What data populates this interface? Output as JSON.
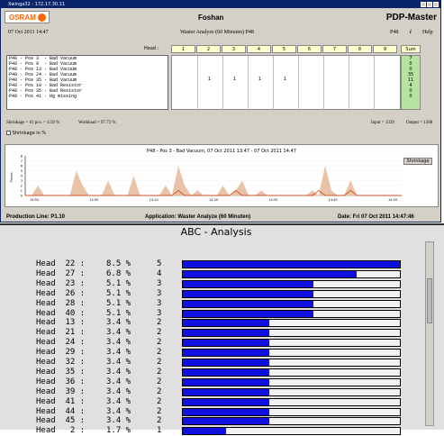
{
  "window": {
    "title": "Xwinga32 - 172.17.30.11"
  },
  "header": {
    "brand": "OSRAM",
    "city": "Foshan",
    "app": "PDP-Master"
  },
  "subheader": {
    "date": "07 Oct 2011 14:47",
    "title": "Waster Analyze (60 Minuten) P48",
    "machine": "P48",
    "info": "i",
    "help": "Help"
  },
  "grid": {
    "head_label": "Head :",
    "heads": [
      "1",
      "2",
      "3",
      "4",
      "5",
      "6",
      "7",
      "8",
      "9"
    ],
    "sum_label": "Sum",
    "rows": [
      {
        "label": "P48 - Pos 3  - Bad Vacuum",
        "values": [
          "",
          "",
          "",
          "",
          "",
          "",
          "",
          "",
          ""
        ],
        "sum": "7"
      },
      {
        "label": "P48 - Pos 9  - Bad Vacuum",
        "values": [
          "",
          "",
          "",
          "",
          "",
          "",
          "",
          "",
          ""
        ],
        "sum": "0"
      },
      {
        "label": "P48 - Pos 13 - Bad Vacuum",
        "values": [
          "",
          "",
          "",
          "",
          "",
          "",
          "",
          "",
          ""
        ],
        "sum": "0"
      },
      {
        "label": "P48 - Pos 24 - Bad Vacuum",
        "values": [
          "",
          "1",
          "1",
          "1",
          "1",
          "",
          "",
          "",
          ""
        ],
        "sum": "35"
      },
      {
        "label": "P48 - Pos 35 - Bad Vacuum",
        "values": [
          "",
          "",
          "",
          "",
          "",
          "",
          "",
          "",
          ""
        ],
        "sum": "11"
      },
      {
        "label": "P48 - Pos 10 - Bad Resistor",
        "values": [
          "",
          "",
          "",
          "",
          "",
          "",
          "",
          "",
          ""
        ],
        "sum": "4"
      },
      {
        "label": "P48 - Pos 35 - Bad Resistor",
        "values": [
          "",
          "",
          "",
          "",
          "",
          "",
          "",
          "",
          ""
        ],
        "sum": "0"
      },
      {
        "label": "P48 - Pos 41 - Hg missing",
        "values": [
          "",
          "",
          "",
          "",
          "",
          "",
          "",
          "",
          ""
        ],
        "sum": "0"
      }
    ]
  },
  "stats": {
    "shrinkage": "Shrinkage = 61 pcs. = 4.59 %",
    "workload": "Workload = 97.72 %",
    "input": "Input = 1329",
    "output": "Output = 1268"
  },
  "checkbox": {
    "label": "Shrinkage in %"
  },
  "chart": {
    "title": "P48 - Pos 3 - Bad Vacuum,   07 Oct 2011 13:47 - 07 Oct 2011 14:47",
    "button": "Shrinkage",
    "ylabel": "Pieces",
    "yticks": [
      "8",
      "7",
      "6",
      "5",
      "4",
      "3",
      "2",
      "1",
      "0"
    ],
    "xticks": [
      "13:50",
      "14:00",
      "14:10",
      "14:20",
      "14:30",
      "14:40",
      "14:50"
    ]
  },
  "chart_data": {
    "type": "area",
    "title": "P48 - Pos 3 - Bad Vacuum,   07 Oct 2011 13:47 - 07 Oct 2011 14:47",
    "ylim": [
      0,
      8
    ],
    "x": [
      0,
      1,
      2,
      3,
      4,
      5,
      6,
      7,
      8,
      9,
      10,
      11,
      12,
      13,
      14,
      15,
      16,
      17,
      18,
      19,
      20,
      21,
      22,
      23,
      24,
      25,
      26,
      27,
      28,
      29,
      30,
      31,
      32,
      33,
      34,
      35,
      36,
      37,
      38,
      39,
      40,
      41,
      42,
      43,
      44,
      45,
      46,
      47,
      48,
      49,
      50,
      51,
      52,
      53,
      54,
      55,
      56,
      57,
      58,
      59
    ],
    "series": [
      {
        "values": [
          0,
          0,
          2,
          0,
          0,
          0,
          0,
          0,
          5,
          2,
          0,
          0,
          0,
          3,
          0,
          0,
          0,
          4,
          0,
          0,
          0,
          0,
          2,
          0,
          6,
          2,
          0,
          1,
          0,
          0,
          0,
          2,
          0,
          1,
          3,
          0,
          0,
          1,
          0,
          0,
          0,
          0,
          0,
          0,
          0,
          1,
          0,
          6,
          1,
          0,
          0,
          3,
          0,
          0,
          0,
          0,
          0,
          0,
          0,
          0
        ]
      },
      {
        "values": [
          0,
          0,
          0,
          0,
          0,
          0,
          0,
          0,
          0,
          0,
          0,
          0,
          0,
          0,
          0,
          0,
          0,
          0,
          0,
          0,
          0,
          0,
          0,
          0,
          1,
          0,
          0,
          0,
          0,
          0,
          0,
          0,
          0,
          1,
          0,
          0,
          0,
          0,
          0,
          0,
          0,
          0,
          0,
          0,
          0,
          0,
          1,
          0,
          0,
          0,
          0,
          1,
          0,
          0,
          0,
          0,
          0,
          0,
          0,
          0
        ]
      }
    ],
    "grid": true
  },
  "footer": {
    "line": "Production Line:  P1.10",
    "application": "Application:  Waster Analyze (60 Minuten)",
    "date": "Date:  Fri 07 Oct 2011 14:47:46"
  },
  "abc": {
    "title": "ABC - Analysis",
    "rows": [
      {
        "name": "Head  22 :",
        "pct": "8.5 %",
        "count": "5",
        "fill": 1.0
      },
      {
        "name": "Head  27 :",
        "pct": "6.8 %",
        "count": "4",
        "fill": 0.8
      },
      {
        "name": "Head  23 :",
        "pct": "5.1 %",
        "count": "3",
        "fill": 0.6
      },
      {
        "name": "Head  26 :",
        "pct": "5.1 %",
        "count": "3",
        "fill": 0.6
      },
      {
        "name": "Head  28 :",
        "pct": "5.1 %",
        "count": "3",
        "fill": 0.6
      },
      {
        "name": "Head  40 :",
        "pct": "5.1 %",
        "count": "3",
        "fill": 0.6
      },
      {
        "name": "Head  13 :",
        "pct": "3.4 %",
        "count": "2",
        "fill": 0.4
      },
      {
        "name": "Head  21 :",
        "pct": "3.4 %",
        "count": "2",
        "fill": 0.4
      },
      {
        "name": "Head  24 :",
        "pct": "3.4 %",
        "count": "2",
        "fill": 0.4
      },
      {
        "name": "Head  29 :",
        "pct": "3.4 %",
        "count": "2",
        "fill": 0.4
      },
      {
        "name": "Head  32 :",
        "pct": "3.4 %",
        "count": "2",
        "fill": 0.4
      },
      {
        "name": "Head  35 :",
        "pct": "3.4 %",
        "count": "2",
        "fill": 0.4
      },
      {
        "name": "Head  36 :",
        "pct": "3.4 %",
        "count": "2",
        "fill": 0.4
      },
      {
        "name": "Head  39 :",
        "pct": "3.4 %",
        "count": "2",
        "fill": 0.4
      },
      {
        "name": "Head  41 :",
        "pct": "3.4 %",
        "count": "2",
        "fill": 0.4
      },
      {
        "name": "Head  44 :",
        "pct": "3.4 %",
        "count": "2",
        "fill": 0.4
      },
      {
        "name": "Head  45 :",
        "pct": "3.4 %",
        "count": "2",
        "fill": 0.4
      },
      {
        "name": "Head   2 :",
        "pct": "1.7 %",
        "count": "1",
        "fill": 0.2
      }
    ]
  }
}
